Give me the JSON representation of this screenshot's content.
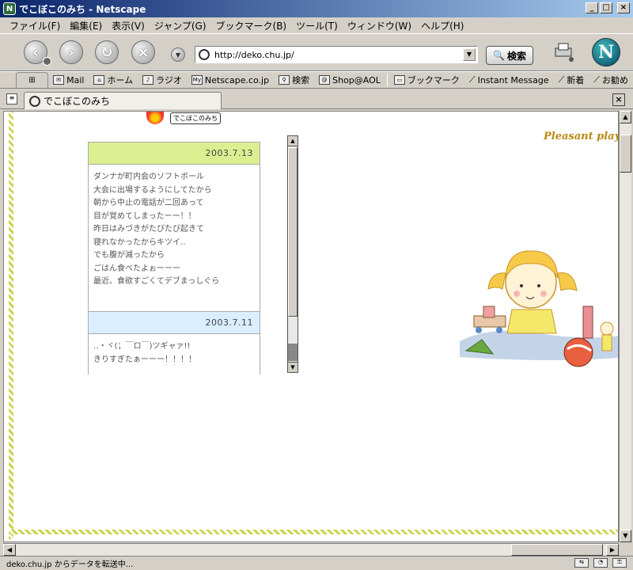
{
  "window": {
    "title": "でこぼこのみち - Netscape",
    "app_icon": "netscape-n-icon"
  },
  "menu": {
    "items": [
      "ファイル(F)",
      "編集(E)",
      "表示(V)",
      "ジャンプ(G)",
      "ブックマーク(B)",
      "ツール(T)",
      "ウィンドウ(W)",
      "ヘルプ(H)"
    ]
  },
  "navigation": {
    "url": "http://deko.chu.jp/",
    "search_label": "検索"
  },
  "bookmarks": {
    "items": [
      {
        "label": "Mail",
        "icon": "mail-icon"
      },
      {
        "label": "ホーム",
        "icon": "home-icon"
      },
      {
        "label": "ラジオ",
        "icon": "radio-icon"
      },
      {
        "label": "Netscape.co.jp",
        "icon": "my-icon"
      },
      {
        "label": "検索",
        "icon": "search-icon"
      },
      {
        "label": "Shop@AOL",
        "icon": "shop-icon"
      }
    ],
    "items2": [
      {
        "label": "ブックマーク",
        "icon": "folder-icon"
      },
      {
        "label": "Instant Message",
        "icon": "bookmark-icon"
      },
      {
        "label": "新着",
        "icon": "bookmark-icon"
      },
      {
        "label": "お勧め",
        "icon": "bookmark-icon"
      }
    ]
  },
  "tab": {
    "title": "でこぼこのみち"
  },
  "page": {
    "logo_label": "でこぼこのみち",
    "entries": [
      {
        "date": "2003.7.13",
        "lines": [
          "ダンナが町内会のソフトボール",
          "大会に出場するようにしてたから",
          "朝から中止の電話が二回あって",
          "目が覚めてしまったーー！！",
          "昨日はみづきがたびたび起きて",
          "寝れなかったからキツイ‥",
          "でも腹が減ったから",
          "ごはん食べたよぉーーー",
          "最近、食欲すごくてデブまっしぐら"
        ]
      },
      {
        "date": "2003.7.11",
        "lines": [
          "‥・ヾ(；￣ロ￣)ツギャァ!!",
          "きりすぎたぁーーー！！！！"
        ]
      }
    ],
    "illustration_text": "Pleasant play"
  },
  "status": {
    "text": "deko.chu.jp からデータを転送中..."
  }
}
